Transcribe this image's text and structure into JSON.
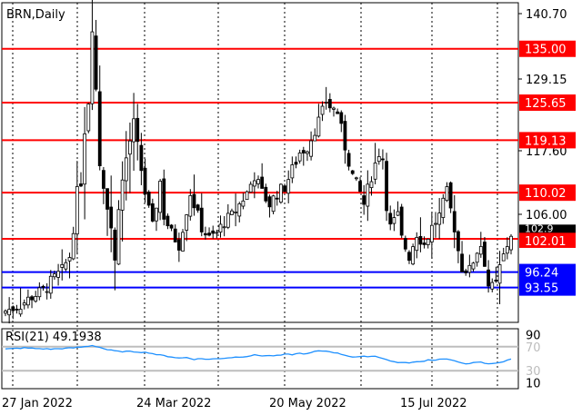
{
  "symbol_label": "BRN,Daily",
  "chart_data": {
    "type": "candlestick",
    "title": "BRN,Daily",
    "price_axis": {
      "ticks": [
        "140.70",
        "129.15",
        "117.60",
        "106.00"
      ],
      "range": [
        87.5,
        143.0
      ]
    },
    "date_axis": {
      "labels": [
        "27 Jan 2022",
        "24 Mar 2022",
        "20 May 2022",
        "15 Jul 2022"
      ]
    },
    "levels": [
      {
        "value": 135.0,
        "label": "135.00",
        "color": "#ff0000"
      },
      {
        "value": 125.65,
        "label": "125.65",
        "color": "#ff0000"
      },
      {
        "value": 119.13,
        "label": "119.13",
        "color": "#ff0000"
      },
      {
        "value": 110.02,
        "label": "110.02",
        "color": "#ff0000"
      },
      {
        "value": 102.01,
        "label": "102.01",
        "color": "#ff0000"
      },
      {
        "value": 96.24,
        "label": "96.24",
        "color": "#0000ff"
      },
      {
        "value": 93.55,
        "label": "93.55",
        "color": "#0000ff"
      }
    ],
    "last_price_label": "102.9",
    "close_path": [
      [
        0,
        89.5
      ],
      [
        4,
        90.5
      ],
      [
        7,
        92
      ],
      [
        10,
        93
      ],
      [
        12,
        94.5
      ],
      [
        15,
        96.5
      ],
      [
        17,
        99
      ],
      [
        18,
        104
      ],
      [
        19,
        110
      ],
      [
        20,
        112
      ],
      [
        21,
        121
      ],
      [
        22,
        126
      ],
      [
        23,
        139
      ],
      [
        24,
        128
      ],
      [
        25,
        115
      ],
      [
        27,
        108
      ],
      [
        28,
        104
      ],
      [
        29,
        98
      ],
      [
        30,
        108
      ],
      [
        32,
        116
      ],
      [
        34,
        122
      ],
      [
        35,
        118
      ],
      [
        36,
        114
      ],
      [
        37,
        110
      ],
      [
        39,
        104
      ],
      [
        41,
        112
      ],
      [
        42,
        106
      ],
      [
        44,
        103
      ],
      [
        46,
        101
      ],
      [
        47,
        104
      ],
      [
        49,
        110
      ],
      [
        51,
        106
      ],
      [
        52,
        104
      ],
      [
        54,
        102
      ],
      [
        56,
        103
      ],
      [
        58,
        105
      ],
      [
        60,
        106
      ],
      [
        62,
        108
      ],
      [
        64,
        110
      ],
      [
        66,
        113
      ],
      [
        68,
        110
      ],
      [
        70,
        108
      ],
      [
        72,
        110
      ],
      [
        74,
        111
      ],
      [
        76,
        114
      ],
      [
        78,
        117
      ],
      [
        80,
        118
      ],
      [
        82,
        121
      ],
      [
        84,
        124
      ],
      [
        85,
        126
      ],
      [
        86,
        125
      ],
      [
        88,
        124
      ],
      [
        90,
        118
      ],
      [
        92,
        113
      ],
      [
        94,
        110
      ],
      [
        95,
        108
      ],
      [
        97,
        113
      ],
      [
        99,
        117
      ],
      [
        100,
        116
      ],
      [
        101,
        108
      ],
      [
        102,
        104
      ],
      [
        104,
        106
      ],
      [
        105,
        102
      ],
      [
        107,
        99
      ],
      [
        109,
        103
      ],
      [
        111,
        101
      ],
      [
        113,
        104
      ],
      [
        115,
        106
      ],
      [
        117,
        110
      ],
      [
        119,
        104
      ],
      [
        120,
        100
      ],
      [
        121,
        97
      ],
      [
        123,
        96.5
      ],
      [
        125,
        100
      ],
      [
        126,
        101
      ],
      [
        127,
        98
      ],
      [
        128,
        94
      ],
      [
        129,
        93.5
      ],
      [
        130,
        94
      ],
      [
        131,
        97
      ],
      [
        133,
        101
      ],
      [
        134,
        102.9
      ]
    ],
    "rsi": {
      "label": "RSI(21) 49.1938",
      "ticks": [
        "90",
        "70",
        "30",
        "10"
      ],
      "range": [
        0,
        100
      ],
      "level_lines": [
        70,
        30
      ],
      "path": [
        [
          0,
          66
        ],
        [
          5,
          68
        ],
        [
          8,
          67
        ],
        [
          12,
          66
        ],
        [
          15,
          67
        ],
        [
          18,
          68
        ],
        [
          21,
          70
        ],
        [
          23,
          72
        ],
        [
          25,
          69
        ],
        [
          27,
          65
        ],
        [
          30,
          62
        ],
        [
          33,
          62
        ],
        [
          36,
          61
        ],
        [
          38,
          60
        ],
        [
          40,
          57
        ],
        [
          42,
          55
        ],
        [
          44,
          53
        ],
        [
          46,
          51
        ],
        [
          48,
          52
        ],
        [
          50,
          49
        ],
        [
          52,
          50
        ],
        [
          54,
          49
        ],
        [
          56,
          50
        ],
        [
          58,
          51
        ],
        [
          60,
          52
        ],
        [
          62,
          53
        ],
        [
          64,
          54
        ],
        [
          66,
          56
        ],
        [
          68,
          55
        ],
        [
          70,
          55
        ],
        [
          72,
          55
        ],
        [
          74,
          57
        ],
        [
          76,
          57
        ],
        [
          78,
          59
        ],
        [
          80,
          58
        ],
        [
          82,
          62
        ],
        [
          84,
          63
        ],
        [
          86,
          62
        ],
        [
          88,
          59
        ],
        [
          90,
          56
        ],
        [
          92,
          53
        ],
        [
          94,
          53
        ],
        [
          96,
          54
        ],
        [
          98,
          54
        ],
        [
          100,
          51
        ],
        [
          102,
          46
        ],
        [
          104,
          44
        ],
        [
          106,
          43
        ],
        [
          108,
          44
        ],
        [
          110,
          45
        ],
        [
          112,
          48
        ],
        [
          114,
          48
        ],
        [
          116,
          50
        ],
        [
          118,
          48
        ],
        [
          120,
          44
        ],
        [
          122,
          42
        ],
        [
          124,
          43
        ],
        [
          126,
          44
        ],
        [
          128,
          41
        ],
        [
          130,
          43
        ],
        [
          132,
          45
        ],
        [
          134,
          49.2
        ]
      ]
    }
  }
}
